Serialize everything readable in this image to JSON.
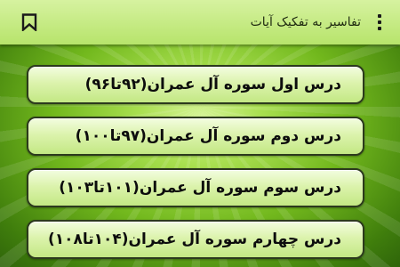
{
  "toolbar": {
    "title": "تفاسیر به تفکیک آیات",
    "bookmark_icon": "bookmark-icon",
    "menu_icon": "overflow-menu-icon"
  },
  "lessons": [
    {
      "label": "درس اول سوره آل عمران(۹۲تا۹۶)"
    },
    {
      "label": "درس دوم سوره آل عمران(۹۷تا۱۰۰)"
    },
    {
      "label": "درس سوم سوره آل عمران(۱۰۱تا۱۰۳)"
    },
    {
      "label": "درس چهارم سوره آل عمران(۱۰۴تا۱۰۸)"
    }
  ],
  "colors": {
    "toolbar": "#c6ea86",
    "background": "#72b81d",
    "button_fill": "#dcf3ad",
    "button_border": "#2c3a1d"
  }
}
